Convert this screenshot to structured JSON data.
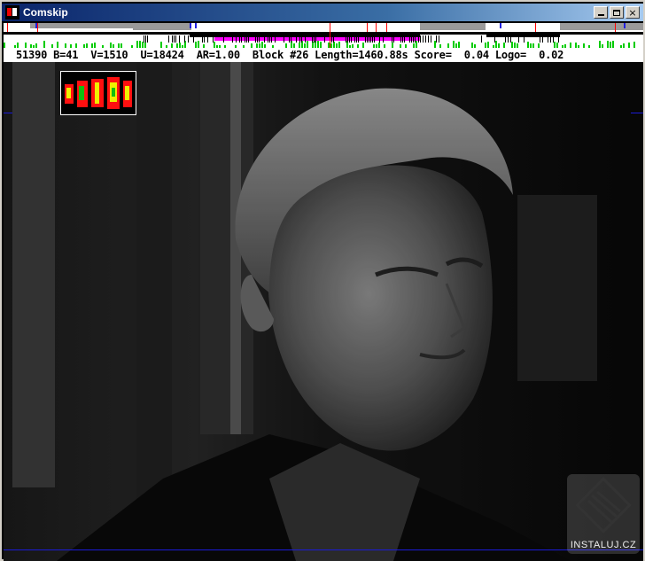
{
  "window": {
    "title": "Comskip",
    "minimize_label": "_",
    "maximize_label": "",
    "close_label": "×"
  },
  "status": {
    "text": "51390 B=41  V=1510  U=18424  AR=1.00  Block #26 Length=1460.88s Score=  0.04 Logo=  0.02"
  },
  "watermark": {
    "label": "INSTALUJ.CZ"
  },
  "colors": {
    "titlebar_start": "#0a246a",
    "titlebar_end": "#a6caf0",
    "timeline_magenta": "#ff00ff",
    "timeline_green": "#00cc00",
    "timeline_red": "#ff0000",
    "timeline_blue": "#2020e0",
    "logo_red": "#ff1010",
    "logo_yellow": "#f0f000",
    "logo_green": "#10c010"
  },
  "icons": {
    "app": "comskip-app-icon",
    "minimize": "minimize-icon",
    "maximize": "maximize-icon",
    "close": "close-icon",
    "watermark": "instaluj-logo-icon"
  }
}
